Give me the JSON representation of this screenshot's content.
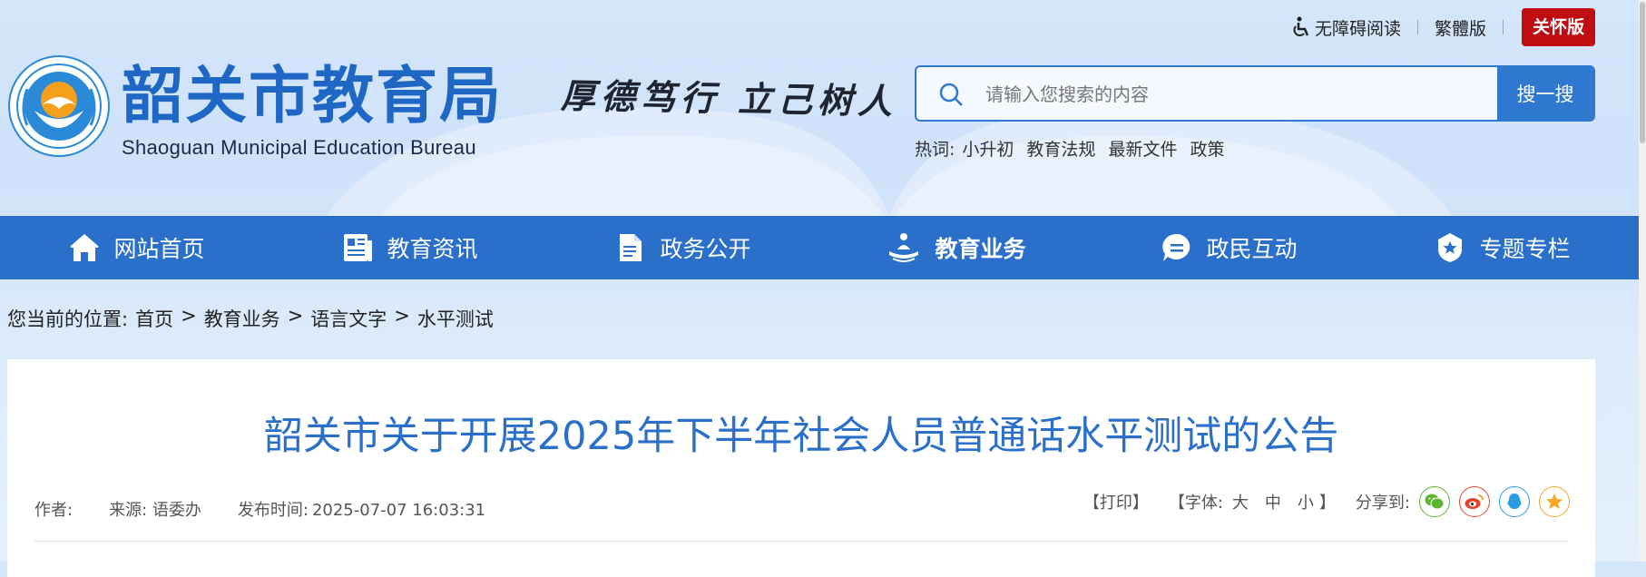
{
  "topbar": {
    "accessibility": "无障碍阅读",
    "traditional": "繁體版",
    "care": "关怀版"
  },
  "brand": {
    "name_cn": "韶关市教育局",
    "name_en": "Shaoguan Municipal Education Bureau",
    "logo_text": "韶关市教育局",
    "motto": "厚德笃行  立己树人"
  },
  "search": {
    "placeholder": "请输入您搜索的内容",
    "button": "搜一搜",
    "hot_label": "热词:",
    "hot_words": [
      "小升初",
      "教育法规",
      "最新文件",
      "政策"
    ]
  },
  "nav": {
    "items": [
      {
        "label": "网站首页",
        "icon": "home-icon"
      },
      {
        "label": "教育资讯",
        "icon": "news-icon"
      },
      {
        "label": "政务公开",
        "icon": "document-icon"
      },
      {
        "label": "教育业务",
        "icon": "education-icon",
        "active": true
      },
      {
        "label": "政民互动",
        "icon": "chat-icon"
      },
      {
        "label": "专题专栏",
        "icon": "topic-icon"
      }
    ]
  },
  "breadcrumb": {
    "label": "您当前的位置:",
    "items": [
      "首页",
      "教育业务",
      "语言文字",
      "水平测试"
    ],
    "separator": ">"
  },
  "article": {
    "title": "韶关市关于开展2025年下半年社会人员普通话水平测试的公告",
    "author_label": "作者:",
    "source": "来源: 语委办",
    "publish_label": "发布时间:",
    "publish_time": "2025-07-07 16:03:31",
    "print": "【打印】",
    "font_label": "【字体:",
    "font_sizes": [
      "大",
      "中",
      "小"
    ],
    "font_close": "】",
    "share_label": "分享到:",
    "share_icons": [
      "wechat-icon",
      "weibo-icon",
      "qq-icon",
      "qzone-icon"
    ]
  },
  "colors": {
    "primary": "#2a6fca",
    "care_red": "#c00d12",
    "wechat": "#5cb531",
    "weibo": "#e6432b",
    "qq": "#2d9be3",
    "qzone": "#f5a623"
  }
}
